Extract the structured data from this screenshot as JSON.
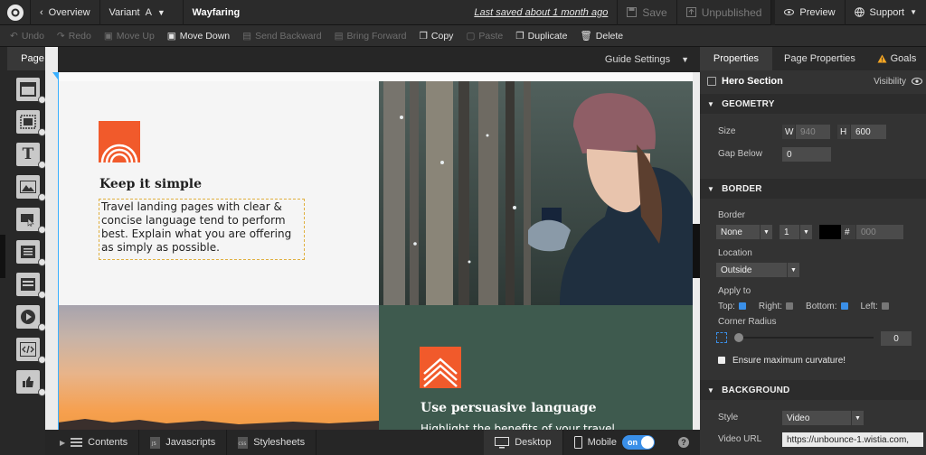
{
  "topbar": {
    "back_label": "Overview",
    "variant_label": "Variant",
    "variant_value": "A",
    "page_title": "Wayfaring",
    "last_saved": "Last saved  about 1 month ago",
    "save_label": "Save",
    "unpublished_label": "Unpublished",
    "preview_label": "Preview",
    "support_label": "Support"
  },
  "toolbar": {
    "undo": "Undo",
    "redo": "Redo",
    "move_up": "Move Up",
    "move_down": "Move Down",
    "send_backward": "Send Backward",
    "bring_forward": "Bring Forward",
    "copy": "Copy",
    "paste": "Paste",
    "duplicate": "Duplicate",
    "delete": "Delete"
  },
  "left_rail": {
    "tab_label": "Page"
  },
  "canvas": {
    "guide_settings": "Guide Settings",
    "hero_heading": "Keep it simple",
    "hero_body": "Travel landing pages with clear & concise language tend to perform best. Explain what you are offering as simply as possible.",
    "second_heading": "Use persuasive language",
    "second_body": "Highlight the benefits of your travel"
  },
  "properties": {
    "tabs": [
      "Properties",
      "Page Properties",
      "Goals"
    ],
    "element_name": "Hero Section",
    "visibility_label": "Visibility",
    "geometry": {
      "title": "GEOMETRY",
      "size_label": "Size",
      "w_label": "W",
      "w_value": "940",
      "h_label": "H",
      "h_value": "600",
      "gap_label": "Gap Below",
      "gap_value": "0"
    },
    "border": {
      "title": "BORDER",
      "border_label": "Border",
      "style_value": "None",
      "width_value": "1",
      "hash": "#",
      "color_value": "000",
      "location_label": "Location",
      "location_value": "Outside",
      "apply_label": "Apply to",
      "top_label": "Top:",
      "right_label": "Right:",
      "bottom_label": "Bottom:",
      "left_label": "Left:",
      "corner_label": "Corner Radius",
      "corner_value": "0",
      "max_curve_label": "Ensure maximum curvature!"
    },
    "background": {
      "title": "BACKGROUND",
      "style_label": "Style",
      "style_value": "Video",
      "video_url_label": "Video URL",
      "video_url_value": "https://unbounce-1.wistia.com,"
    }
  },
  "bottombar": {
    "contents": "Contents",
    "javascripts": "Javascripts",
    "stylesheets": "Stylesheets",
    "desktop": "Desktop",
    "mobile": "Mobile",
    "mobile_toggle": "on",
    "help": "?"
  },
  "colors": {
    "accent_blue": "#3a8fe8",
    "brand_orange": "#f15a2b",
    "goals_warning": "#f5a623"
  }
}
